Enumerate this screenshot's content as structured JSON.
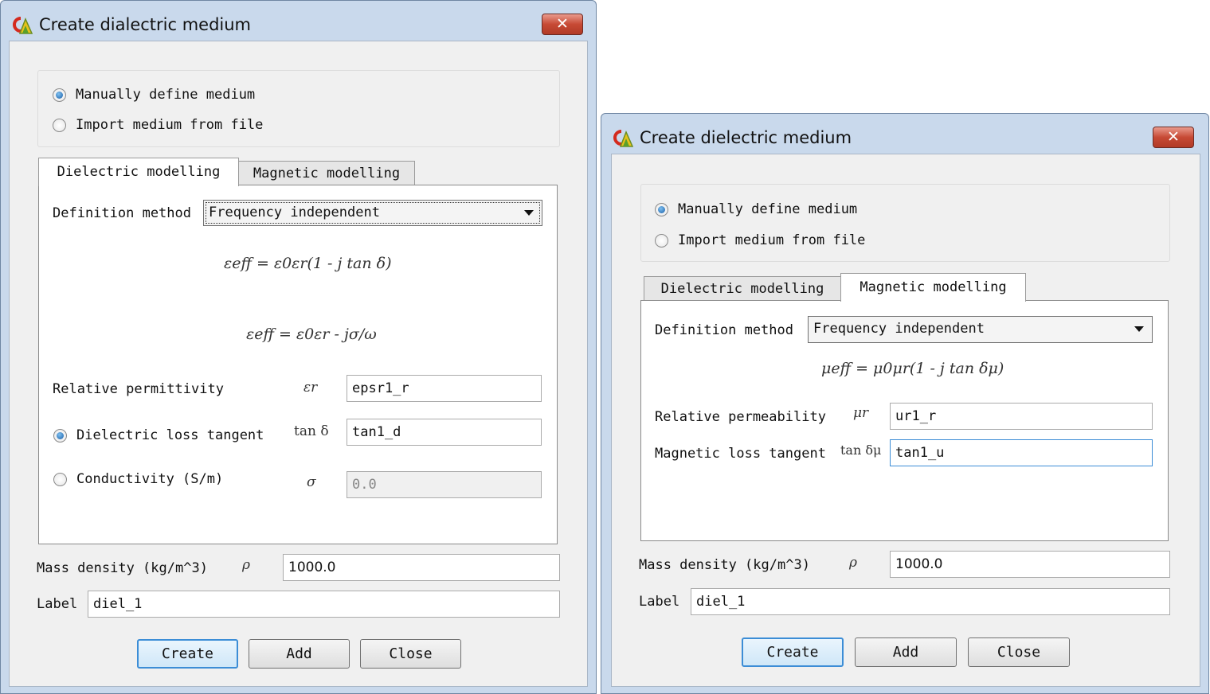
{
  "left_dialog": {
    "title": "Create dialectric medium",
    "close_label": "✕",
    "source_options": [
      {
        "label": "Manually define medium",
        "selected": true
      },
      {
        "label": "Import medium from file",
        "selected": false
      }
    ],
    "tabs": [
      {
        "label": "Dielectric modelling",
        "active": true
      },
      {
        "label": "Magnetic modelling",
        "active": false
      }
    ],
    "definition_method_label": "Definition method",
    "definition_method_value": "Frequency independent",
    "formula_1": "εeff = ε0εr(1 - j tan δ)",
    "formula_2": "εeff = ε0εr - jσ/ω",
    "relative_permittivity": {
      "label": "Relative permittivity",
      "symbol": "εr",
      "value": "epsr1_r"
    },
    "loss_tangent": {
      "label": "Dielectric loss tangent",
      "symbol": "tan δ",
      "value": "tan1_d",
      "selected": true
    },
    "conductivity": {
      "label": "Conductivity (S/m)",
      "symbol": "σ",
      "value": "0.0",
      "selected": false
    },
    "mass_density": {
      "label": "Mass density (kg/m^3)",
      "symbol": "ρ",
      "value": "1000.0"
    },
    "label_field": {
      "label": "Label",
      "value": "diel_1"
    },
    "buttons": {
      "create": "Create",
      "add": "Add",
      "close": "Close"
    }
  },
  "right_dialog": {
    "title": "Create dielectric medium",
    "close_label": "✕",
    "source_options": [
      {
        "label": "Manually define medium",
        "selected": true
      },
      {
        "label": "Import medium from file",
        "selected": false
      }
    ],
    "tabs": [
      {
        "label": "Dielectric modelling",
        "active": false
      },
      {
        "label": "Magnetic modelling",
        "active": true
      }
    ],
    "definition_method_label": "Definition method",
    "definition_method_value": "Frequency independent",
    "formula": "μeff = μ0μr(1 - j tan δμ)",
    "relative_permeability": {
      "label": "Relative permeability",
      "symbol": "μr",
      "value": "ur1_r"
    },
    "magnetic_loss_tangent": {
      "label": "Magnetic loss tangent",
      "symbol": "tan δμ",
      "value": "tan1_u"
    },
    "mass_density": {
      "label": "Mass density (kg/m^3)",
      "symbol": "ρ",
      "value": "1000.0"
    },
    "label_field": {
      "label": "Label",
      "value": "diel_1"
    },
    "buttons": {
      "create": "Create",
      "add": "Add",
      "close": "Close"
    }
  },
  "colors": {
    "window_frame": "#c9d9ec",
    "client": "#f0f0f0",
    "close_button": "#c74a35",
    "default_button": "#3c8dd6"
  }
}
